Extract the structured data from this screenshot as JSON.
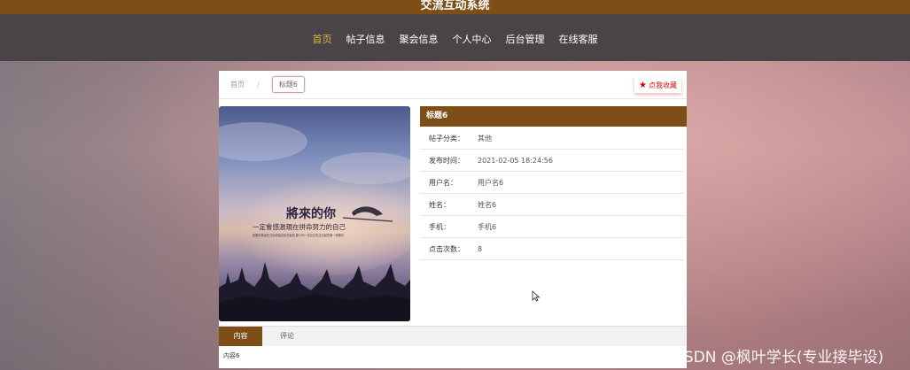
{
  "site": {
    "title": "交流互动系统"
  },
  "nav": {
    "items": [
      {
        "label": "首页",
        "active": true
      },
      {
        "label": "帖子信息",
        "active": false
      },
      {
        "label": "聚会信息",
        "active": false
      },
      {
        "label": "个人中心",
        "active": false
      },
      {
        "label": "后台管理",
        "active": false
      },
      {
        "label": "在线客服",
        "active": false
      }
    ]
  },
  "breadcrumb": {
    "home": "首页",
    "separator": "/",
    "current": "标题6"
  },
  "favorite_button": {
    "label": "点我收藏",
    "icon": "star-icon"
  },
  "photo": {
    "title_text": "將來的你",
    "subtitle_text": "一定會感激現在拼命努力的自己",
    "caption_text": "如果你曾经在日出前独自坐在窗前,那么你一定见过天边泛起的第一抹微光"
  },
  "info": {
    "header": "标题6",
    "rows": [
      {
        "label": "帖子分类：",
        "value": "其他"
      },
      {
        "label": "发布时间：",
        "value": "2021-02-05 18:24:56"
      },
      {
        "label": "用户名：",
        "value": "用户名6"
      },
      {
        "label": "姓名：",
        "value": "姓名6"
      },
      {
        "label": "手机：",
        "value": "手机6"
      },
      {
        "label": "点击次数：",
        "value": "8"
      }
    ]
  },
  "tabs": {
    "items": [
      {
        "label": "内容",
        "active": true
      },
      {
        "label": "评论",
        "active": false
      }
    ],
    "content": "内容6"
  },
  "watermark": "CSDN @枫叶学长(专业接毕设)",
  "colors": {
    "brand": "#7d4f17",
    "nav_bg": "#4a4448",
    "nav_active": "#e0b436",
    "favorite": "#dd1111"
  }
}
